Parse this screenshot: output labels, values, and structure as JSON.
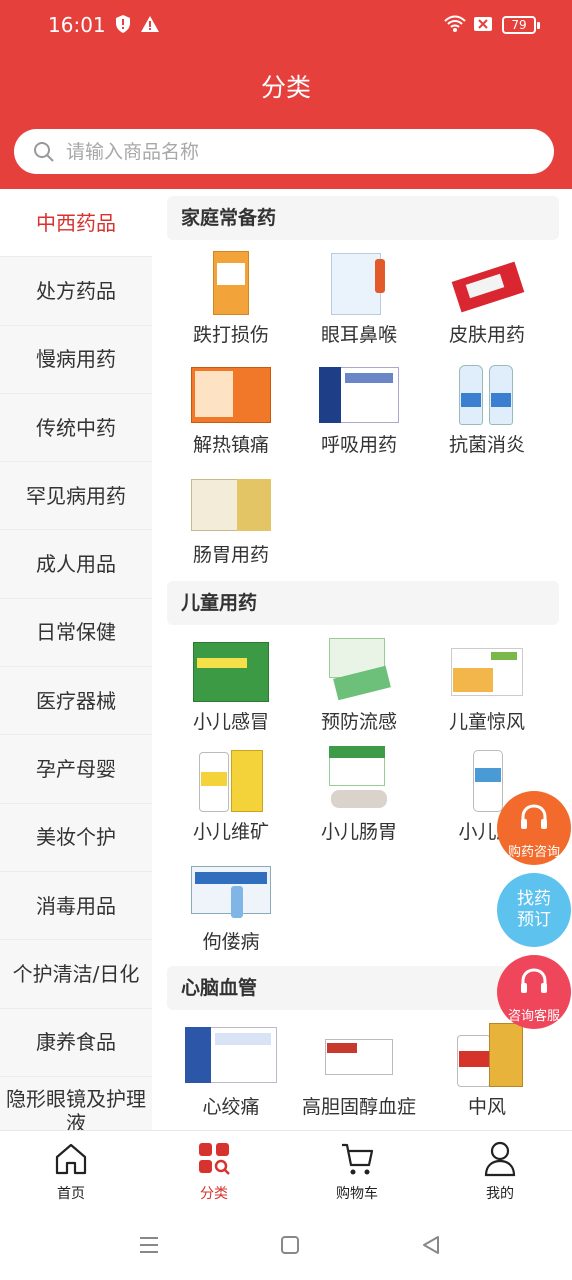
{
  "status_bar": {
    "time": "16:01",
    "battery": "79"
  },
  "header": {
    "title": "分类"
  },
  "search": {
    "placeholder": "请输入商品名称"
  },
  "sidebar": {
    "items": [
      {
        "label": "中西药品",
        "active": true
      },
      {
        "label": "处方药品"
      },
      {
        "label": "慢病用药"
      },
      {
        "label": "传统中药"
      },
      {
        "label": "罕见病用药"
      },
      {
        "label": "成人用品"
      },
      {
        "label": "日常保健"
      },
      {
        "label": "医疗器械"
      },
      {
        "label": "孕产母婴"
      },
      {
        "label": "美妆个护"
      },
      {
        "label": "消毒用品"
      },
      {
        "label": "个护清洁/日化"
      },
      {
        "label": "康养食品"
      },
      {
        "label": "隐形眼镜及护理液"
      }
    ]
  },
  "sections": [
    {
      "title": "家庭常备药",
      "products": [
        "跌打损伤",
        "眼耳鼻喉",
        "皮肤用药",
        "解热镇痛",
        "呼吸用药",
        "抗菌消炎",
        "肠胃用药"
      ]
    },
    {
      "title": "儿童用药",
      "products": [
        "小儿感冒",
        "预防流感",
        "儿童惊风",
        "小儿维矿",
        "小儿肠胃",
        "小儿麻",
        "佝偻病"
      ]
    },
    {
      "title": "心脑血管",
      "products": [
        "心绞痛",
        "高胆固醇血症",
        "中风"
      ]
    }
  ],
  "float_buttons": {
    "consult": "购药咨询",
    "find_drug_line1": "找药",
    "find_drug_line2": "预订",
    "service": "咨询客服"
  },
  "tabbar": {
    "home": "首页",
    "category": "分类",
    "cart": "购物车",
    "mine": "我的"
  },
  "colors": {
    "brand": "#e5403b",
    "active": "#d8322e"
  }
}
